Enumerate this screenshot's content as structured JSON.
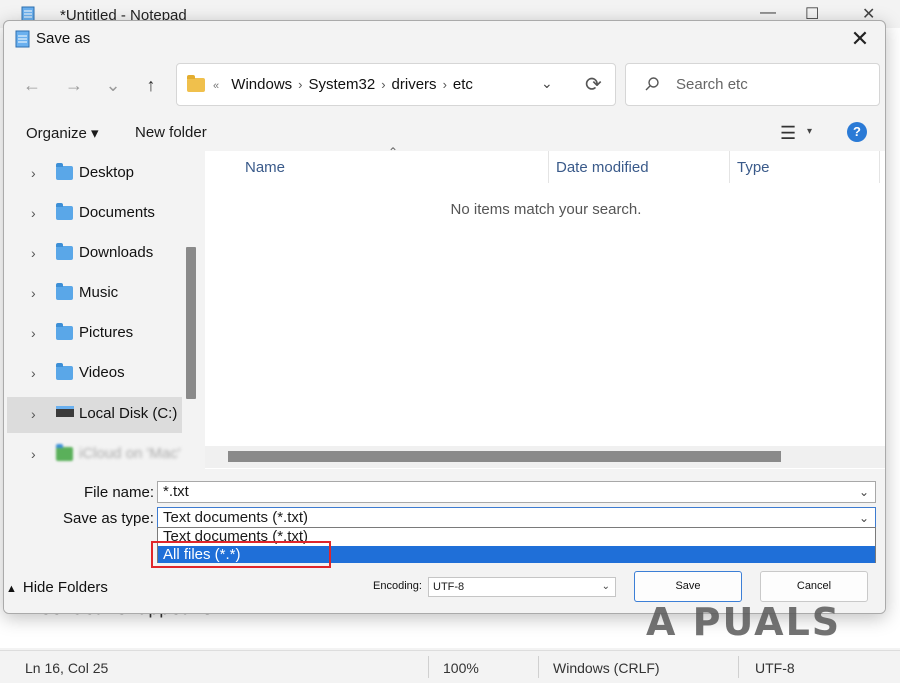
{
  "notepad": {
    "title": "*Untitled - Notepad",
    "text_line": "ilee Scale appears",
    "controls": {
      "minimize": "—",
      "maximize": "☐",
      "close": "✕"
    },
    "status": {
      "position": "Ln 16, Col 25",
      "zoom": "100%",
      "line_ending": "Windows (CRLF)",
      "encoding": "UTF-8"
    }
  },
  "dialog": {
    "title": "Save as",
    "close": "✕",
    "nav": {
      "back": "←",
      "forward": "→",
      "recent": "⌄",
      "up": "↑"
    },
    "address": {
      "overflow": "«",
      "segments": [
        "Windows",
        "System32",
        "drivers",
        "etc"
      ]
    },
    "search": {
      "placeholder": "Search etc"
    },
    "toolbar": {
      "organize": "Organize ▾",
      "new_folder": "New folder",
      "view": "☰",
      "view_dd": "▾",
      "help": "?"
    },
    "nav_pane": {
      "items": [
        {
          "label": "Desktop"
        },
        {
          "label": "Documents"
        },
        {
          "label": "Downloads"
        },
        {
          "label": "Music"
        },
        {
          "label": "Pictures"
        },
        {
          "label": "Videos"
        },
        {
          "label": "Local Disk (C:)"
        },
        {
          "label": "iCloud on 'Mac'"
        }
      ]
    },
    "file_list": {
      "columns": [
        "Name",
        "Date modified",
        "Type"
      ],
      "empty_message": "No items match your search."
    },
    "file_name": {
      "label": "File name:",
      "value": "*.txt"
    },
    "save_type": {
      "label": "Save as type:",
      "value": "Text documents (*.txt)",
      "options": [
        "Text documents (*.txt)",
        "All files  (*.*)"
      ]
    },
    "hide_folders": "Hide Folders",
    "encoding": {
      "label": "Encoding:",
      "value": "UTF-8"
    },
    "buttons": {
      "save": "Save",
      "cancel": "Cancel"
    }
  },
  "watermark": "A PUALS",
  "colors": {
    "accent": "#1f6fd8",
    "highlight_box": "#e0262a",
    "folder": "#5aa7e8"
  }
}
